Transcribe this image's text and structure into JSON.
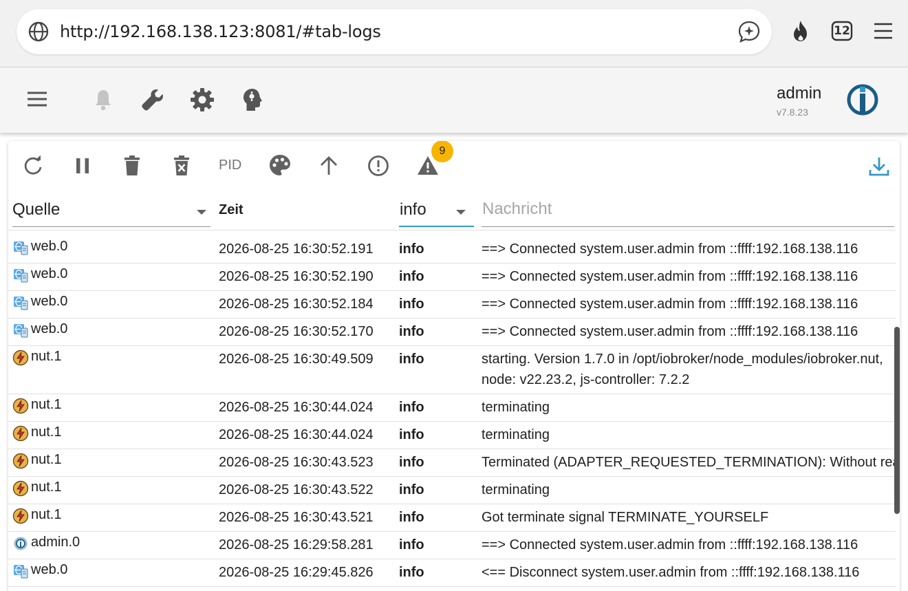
{
  "browser": {
    "url": "http://192.168.138.123:8081/#tab-logs",
    "tab_count": "12",
    "icons": [
      "globe-icon",
      "assistant-icon",
      "fire-icon",
      "tabs-icon",
      "menu-icon"
    ]
  },
  "app": {
    "user": "admin",
    "version": "v7.8.23",
    "icons": [
      "menu-icon",
      "bell-icon",
      "wrench-icon",
      "gear-icon",
      "head-icon",
      "iobroker-logo"
    ]
  },
  "log_toolbar": {
    "pid_label": "PID",
    "warning_count": "9",
    "icons": [
      "refresh-icon",
      "pause-icon",
      "delete-icon",
      "delete-x-icon",
      "palette-icon",
      "arrow-up-icon",
      "error-icon",
      "warning-icon",
      "download-icon"
    ]
  },
  "filters": {
    "source": "Quelle",
    "time": "Zeit",
    "level": "info",
    "message_placeholder": "Nachricht"
  },
  "colors": {
    "accent": "#3399cc",
    "badge": "#f7b500",
    "logo": "#1a5c87"
  },
  "rows": [
    {
      "src": "web.0",
      "icon": "web",
      "time": "2026-08-25 16:30:52.191",
      "level": "info",
      "msg": "==> Connected system.user.admin from ::ffff:192.168.138.116"
    },
    {
      "src": "web.0",
      "icon": "web",
      "time": "2026-08-25 16:30:52.190",
      "level": "info",
      "msg": "==> Connected system.user.admin from ::ffff:192.168.138.116"
    },
    {
      "src": "web.0",
      "icon": "web",
      "time": "2026-08-25 16:30:52.184",
      "level": "info",
      "msg": "==> Connected system.user.admin from ::ffff:192.168.138.116"
    },
    {
      "src": "web.0",
      "icon": "web",
      "time": "2026-08-25 16:30:52.170",
      "level": "info",
      "msg": "==> Connected system.user.admin from ::ffff:192.168.138.116"
    },
    {
      "src": "nut.1",
      "icon": "nut",
      "time": "2026-08-25 16:30:49.509",
      "level": "info",
      "msg": "starting. Version 1.7.0 in /opt/iobroker/node_modules/iobroker.nut, node: v22.23.2, js-controller: 7.2.2",
      "tall": true
    },
    {
      "src": "nut.1",
      "icon": "nut",
      "time": "2026-08-25 16:30:44.024",
      "level": "info",
      "msg": "terminating"
    },
    {
      "src": "nut.1",
      "icon": "nut",
      "time": "2026-08-25 16:30:44.024",
      "level": "info",
      "msg": "terminating"
    },
    {
      "src": "nut.1",
      "icon": "nut",
      "time": "2026-08-25 16:30:43.523",
      "level": "info",
      "msg": "Terminated (ADAPTER_REQUESTED_TERMINATION): Without reason"
    },
    {
      "src": "nut.1",
      "icon": "nut",
      "time": "2026-08-25 16:30:43.522",
      "level": "info",
      "msg": "terminating"
    },
    {
      "src": "nut.1",
      "icon": "nut",
      "time": "2026-08-25 16:30:43.521",
      "level": "info",
      "msg": "Got terminate signal TERMINATE_YOURSELF"
    },
    {
      "src": "admin.0",
      "icon": "admin",
      "time": "2026-08-25 16:29:58.281",
      "level": "info",
      "msg": "==> Connected system.user.admin from ::ffff:192.168.138.116"
    },
    {
      "src": "web.0",
      "icon": "web",
      "time": "2026-08-25 16:29:45.826",
      "level": "info",
      "msg": "<== Disconnect system.user.admin from ::ffff:192.168.138.116"
    }
  ]
}
